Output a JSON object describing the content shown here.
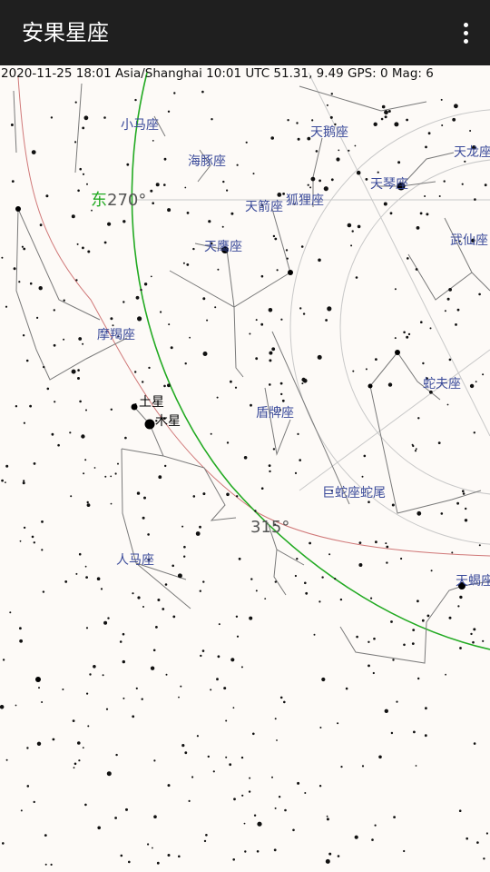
{
  "app": {
    "title": "安果星座",
    "menu_icon": "more-vertical-icon"
  },
  "status_line": "2020-11-25  18:01 Asia/Shanghai  10:01 UTC  51.31, 9.49 GPS: 0  Mag: 6",
  "constellations": [
    "小马座",
    "海豚座",
    "天鹅座",
    "天龙座",
    "天琴座",
    "狐狸座",
    "天箭座",
    "武仙座",
    "天鹰座",
    "摩羯座",
    "蛇夫座",
    "盾牌座",
    "巨蛇座蛇尾",
    "人马座",
    "天蝎座"
  ],
  "planets": [
    "土星",
    "木星"
  ],
  "azimuth_labels": {
    "east": "东",
    "east_deg": "270°",
    "sw_deg": "315°"
  },
  "colors": {
    "horizon": "#22aa22",
    "ecliptic": "#d07878",
    "grid": "#c8c8c8",
    "lines": "#7a7a7a",
    "labels": "#3a4a9a",
    "east": "#22aa22"
  }
}
